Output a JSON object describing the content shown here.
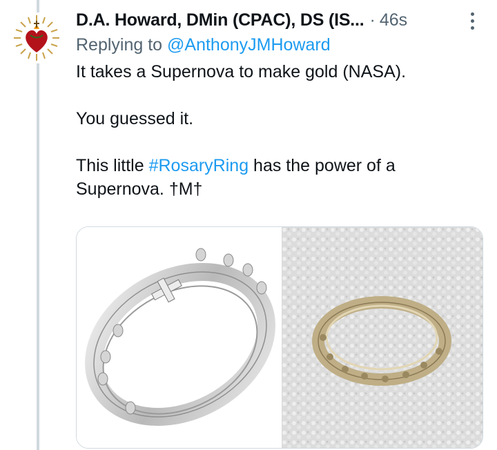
{
  "tweet": {
    "display_name": "D.A. Howard, DMin (CPAC), DS (IS...",
    "separator": "·",
    "timestamp": "46s",
    "reply_prefix": "Replying to ",
    "reply_handle": "@AnthonyJMHoward",
    "paragraph1": "It takes a Supernova to make gold (NASA).",
    "paragraph2": "You guessed it.",
    "paragraph3_before": "This little ",
    "hashtag": "#RosaryRing",
    "paragraph3_after": " has the power of a Supernova. †M†"
  },
  "colors": {
    "link": "#1d9bf0",
    "secondary_text": "#536471",
    "primary_text": "#0f1419",
    "thread_line": "#cfd9de"
  },
  "icons": {
    "avatar": "sacred-heart-icon",
    "more": "more-vertical-icon"
  },
  "media": [
    {
      "name": "silver-rosary-ring-photo"
    },
    {
      "name": "gold-rosary-ring-on-towel-photo"
    }
  ]
}
